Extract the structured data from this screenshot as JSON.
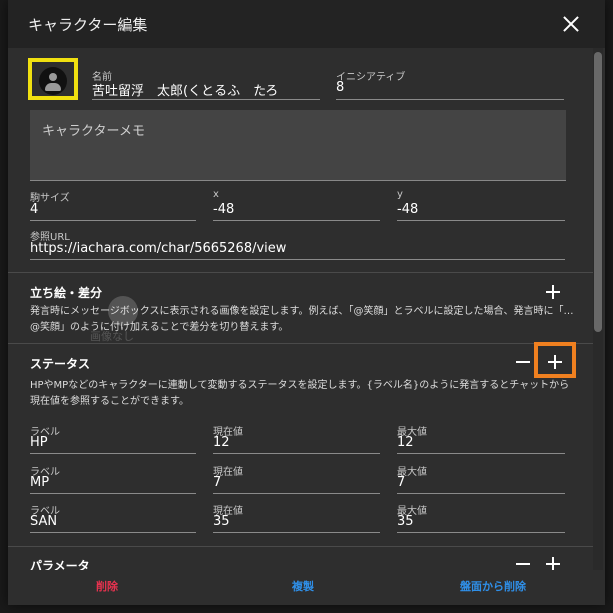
{
  "dialog": {
    "title": "キャラクター編集"
  },
  "fields": {
    "name_label": "名前",
    "name_value": "苦吐留浮　太郎(くとるふ　たろ",
    "initiative_label": "イニシアティブ",
    "initiative_value": "8",
    "memo_placeholder": "キャラクターメモ",
    "size_label": "駒サイズ",
    "size_value": "4",
    "x_label": "x",
    "x_value": "-48",
    "y_label": "y",
    "y_value": "-48",
    "url_label": "参照URL",
    "url_value": "https://iachara.com/char/5665268/view"
  },
  "portrait": {
    "title": "立ち絵・差分",
    "description": "発言時にメッセージボックスに表示される画像を設定します。例えば、「@笑顔」とラベルに設定した場合、発言時に「…@笑顔」のように付け加えることで差分を切り替えます。",
    "ghost_text": "画像なし"
  },
  "status": {
    "title": "ステータス",
    "description": "HPやMPなどのキャラクターに連動して変動するステータスを設定します。{ラベル名}のように発言するとチャットから現在値を参照することができます。",
    "col_label": "ラベル",
    "col_current": "現在値",
    "col_max": "最大値",
    "rows": [
      {
        "label": "HP",
        "current": "12",
        "max": "12"
      },
      {
        "label": "MP",
        "current": "7",
        "max": "7"
      },
      {
        "label": "SAN",
        "current": "35",
        "max": "35"
      }
    ]
  },
  "params": {
    "title": "パラメータ"
  },
  "footer": {
    "delete": "削除",
    "duplicate": "複製",
    "remove_from_board": "盤面から削除"
  },
  "colors": {
    "delete": "#e8324f",
    "action": "#2f8fe8",
    "avatar_highlight": "#f0e010",
    "add_highlight": "#f08020"
  }
}
